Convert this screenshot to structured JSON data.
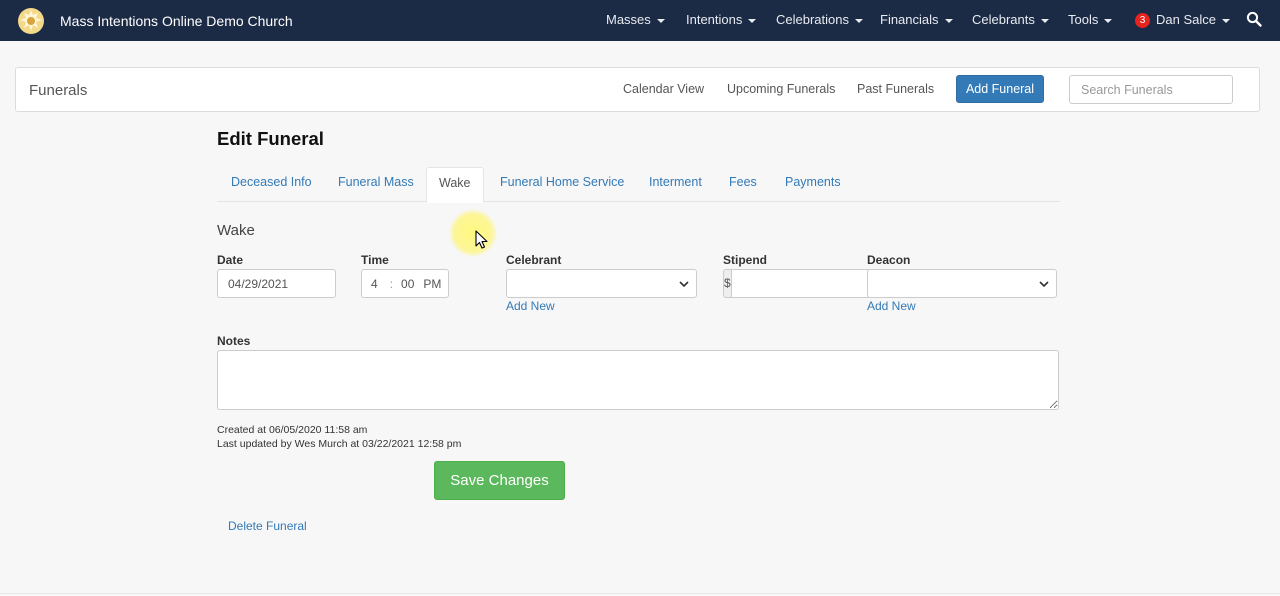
{
  "navbar": {
    "brand_title": "Mass Intentions Online Demo Church",
    "menus": [
      {
        "label": "Masses"
      },
      {
        "label": "Intentions"
      },
      {
        "label": "Celebrations"
      },
      {
        "label": "Financials"
      },
      {
        "label": "Celebrants"
      },
      {
        "label": "Tools"
      }
    ],
    "user": {
      "badge_count": "3",
      "name": "Dan Salce"
    },
    "icons": {
      "logo": "church-logo-icon",
      "search": "search-icon"
    }
  },
  "subheader": {
    "title": "Funerals",
    "links": {
      "calendar": "Calendar View",
      "upcoming": "Upcoming Funerals",
      "past": "Past Funerals"
    },
    "add_button": "Add Funeral",
    "search_placeholder": "Search Funerals"
  },
  "page": {
    "title": "Edit Funeral",
    "tabs": [
      {
        "label": "Deceased Info"
      },
      {
        "label": "Funeral Mass"
      },
      {
        "label": "Wake"
      },
      {
        "label": "Funeral Home Service"
      },
      {
        "label": "Interment"
      },
      {
        "label": "Fees"
      },
      {
        "label": "Payments"
      }
    ],
    "active_tab": "Wake"
  },
  "wake": {
    "section_title": "Wake",
    "date": {
      "label": "Date",
      "value": "04/29/2021"
    },
    "time": {
      "label": "Time",
      "hour": "4",
      "separator": ":",
      "minute": "00",
      "ampm": "PM"
    },
    "celebrant": {
      "label": "Celebrant",
      "value": "",
      "add_new": "Add New"
    },
    "stipend": {
      "label": "Stipend",
      "prefix": "$",
      "value": ""
    },
    "deacon": {
      "label": "Deacon",
      "value": "",
      "add_new": "Add New"
    },
    "notes": {
      "label": "Notes",
      "value": ""
    }
  },
  "meta": {
    "created": "Created at 06/05/2020 11:58 am",
    "updated": "Last updated by Wes Murch at 03/22/2021 12:58 pm"
  },
  "actions": {
    "save": "Save Changes",
    "delete": "Delete Funeral"
  },
  "colors": {
    "navbar_bg": "#1b2a45",
    "link": "#337ab7",
    "primary_button": "#337ab7",
    "success_button": "#5cb85c",
    "badge": "#e8231e"
  }
}
